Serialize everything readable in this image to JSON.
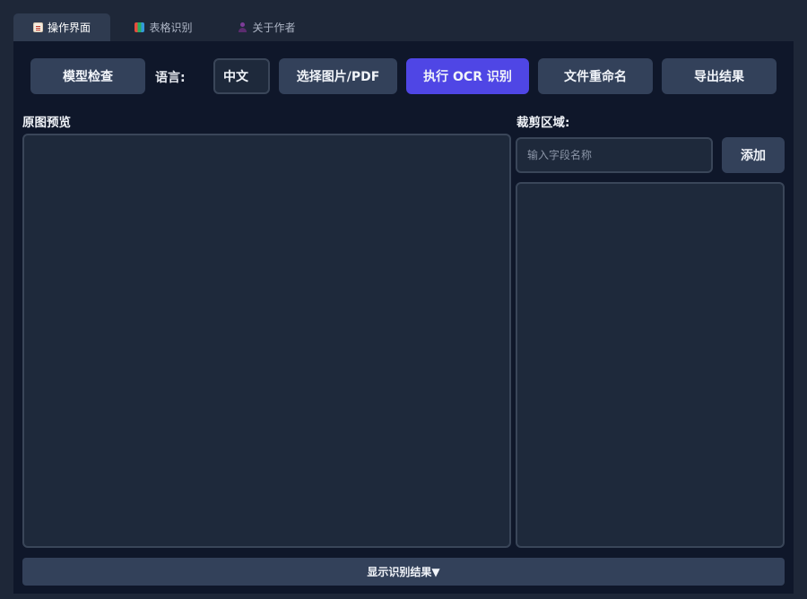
{
  "tabs": [
    {
      "label": "操作界面",
      "icon": "document-icon",
      "active": true
    },
    {
      "label": "表格识别",
      "icon": "chart-icon",
      "active": false
    },
    {
      "label": "关于作者",
      "icon": "person-icon",
      "active": false
    }
  ],
  "toolbar": {
    "model_check": "模型检查",
    "language_label": "语言:",
    "language_value": "中文",
    "select_file": "选择图片/PDF",
    "run_ocr": "执行 OCR 识别",
    "rename_files": "文件重命名",
    "export_results": "导出结果"
  },
  "preview": {
    "label": "原图预览"
  },
  "crop": {
    "label": "裁剪区域:",
    "field_placeholder": "输入字段名称",
    "add_label": "添加"
  },
  "results_toggle": "显示识别结果▼",
  "colors": {
    "primary": "#4f46e5",
    "panel": "#0f172a",
    "button": "#33415a"
  }
}
